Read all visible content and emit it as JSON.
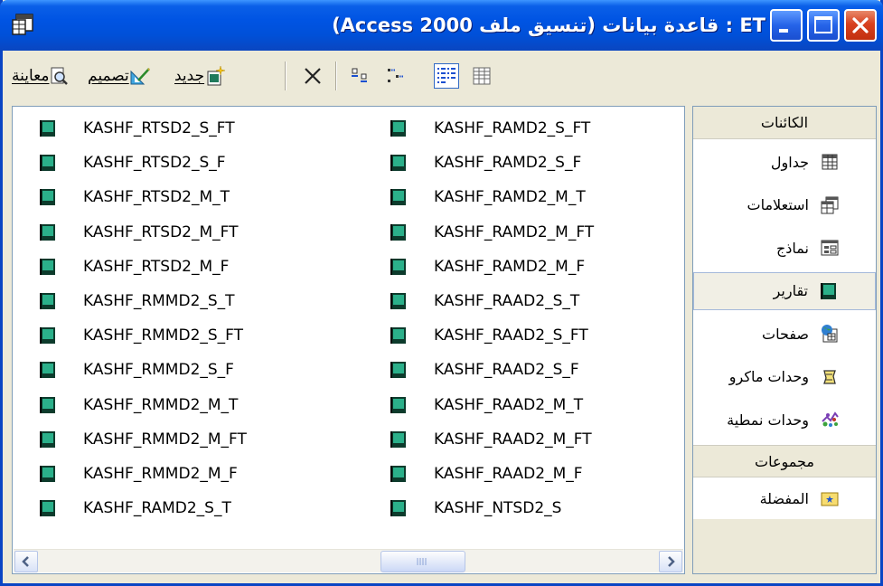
{
  "window": {
    "title": "ET : قاعدة بيانات (تنسيق ملف Access 2000)"
  },
  "toolbar": {
    "preview_label": "معاينة",
    "design_label": "تصميم",
    "new_label": "جديد"
  },
  "reports_col_right": [
    "KASHF_RAMD2_S_FT",
    "KASHF_RAMD2_S_F",
    "KASHF_RAMD2_M_T",
    "KASHF_RAMD2_M_FT",
    "KASHF_RAMD2_M_F",
    "KASHF_RAAD2_S_T",
    "KASHF_RAAD2_S_FT",
    "KASHF_RAAD2_S_F",
    "KASHF_RAAD2_M_T",
    "KASHF_RAAD2_M_FT",
    "KASHF_RAAD2_M_F",
    "KASHF_NTSD2_S"
  ],
  "reports_col_left": [
    "KASHF_RTSD2_S_FT",
    "KASHF_RTSD2_S_F",
    "KASHF_RTSD2_M_T",
    "KASHF_RTSD2_M_FT",
    "KASHF_RTSD2_M_F",
    "KASHF_RMMD2_S_T",
    "KASHF_RMMD2_S_FT",
    "KASHF_RMMD2_S_F",
    "KASHF_RMMD2_M_T",
    "KASHF_RMMD2_M_FT",
    "KASHF_RMMD2_M_F",
    "KASHF_RAMD2_S_T"
  ],
  "objects_bar": {
    "objects_header": "الكائنات",
    "items": [
      {
        "label": "جداول",
        "icon": "table-icon"
      },
      {
        "label": "استعلامات",
        "icon": "query-icon"
      },
      {
        "label": "نماذج",
        "icon": "form-icon"
      },
      {
        "label": "تقارير",
        "icon": "report-icon",
        "selected": true
      },
      {
        "label": "صفحات",
        "icon": "page-icon"
      },
      {
        "label": "وحدات ماكرو",
        "icon": "macro-icon"
      },
      {
        "label": "وحدات نمطية",
        "icon": "module-icon"
      }
    ],
    "groups_header": "مجموعات",
    "favorites_label": "المفضلة"
  },
  "colors": {
    "titlebar": "#0054e3",
    "report_icon": "#1f7a5c"
  }
}
